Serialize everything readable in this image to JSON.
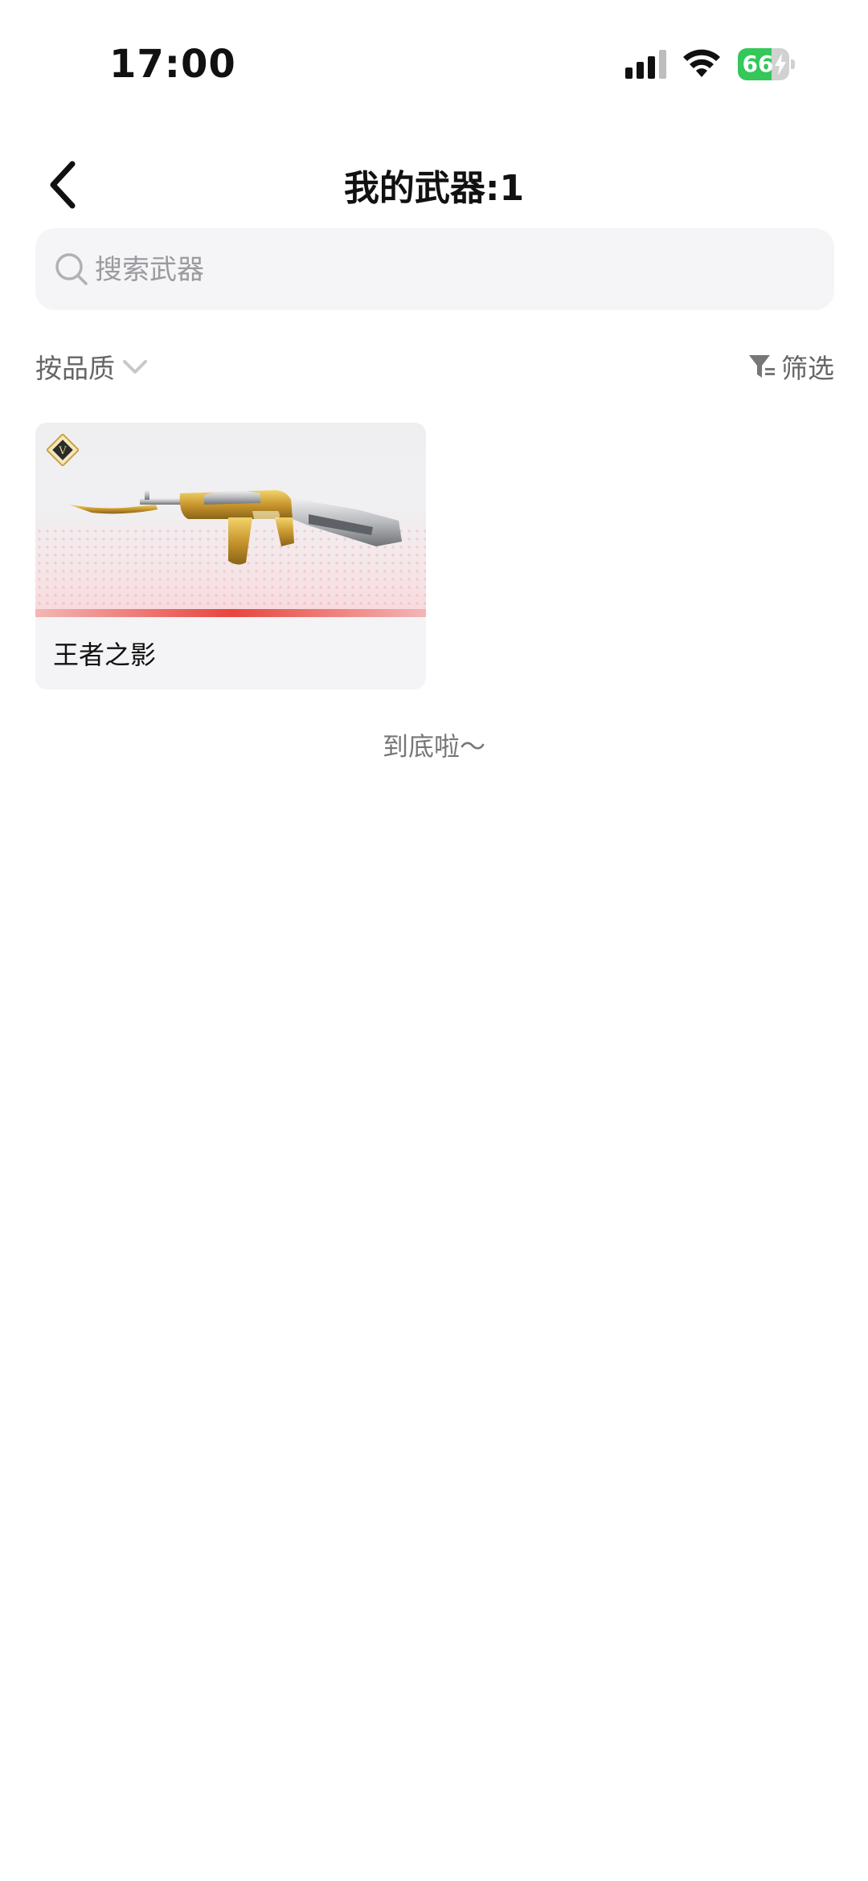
{
  "status_bar": {
    "time": "17:00",
    "battery_percent": 66,
    "battery_label": "66",
    "icons": [
      "cellular-signal-icon",
      "wifi-icon",
      "battery-charging-icon"
    ]
  },
  "header": {
    "title": "我的武器:1",
    "back_icon": "chevron-left-icon"
  },
  "search": {
    "placeholder": "搜索武器",
    "value": "",
    "icon": "search-icon"
  },
  "filters": {
    "sort_label": "按品质",
    "sort_icon": "chevron-down-icon",
    "filter_label": "筛选",
    "filter_icon": "filter-icon"
  },
  "weapons": [
    {
      "name": "王者之影",
      "badge_icon": "v-rank-badge-icon",
      "image": "golden-rifle-image",
      "quality_color": "#e8453e"
    }
  ],
  "list_end_text": "到底啦～",
  "colors": {
    "battery_green": "#34c759",
    "search_bg": "#f5f5f7",
    "secondary_text": "#666666"
  }
}
